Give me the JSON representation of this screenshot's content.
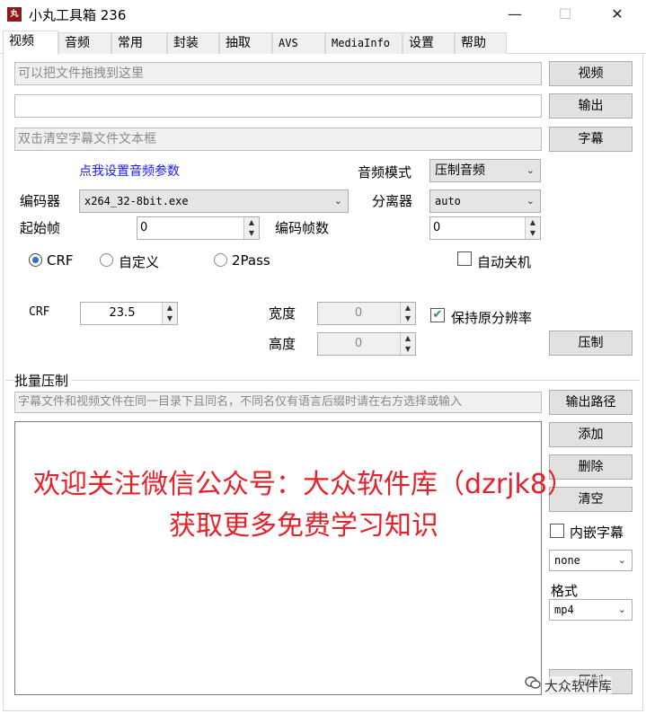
{
  "window": {
    "title": "小丸工具箱 236",
    "minimize_glyph": "—",
    "maximize_glyph": "☐",
    "close_glyph": "✕",
    "app_icon": "app-logo-icon"
  },
  "tabs": [
    {
      "label": "视频",
      "active": true
    },
    {
      "label": "音频",
      "active": false
    },
    {
      "label": "常用",
      "active": false
    },
    {
      "label": "封装",
      "active": false
    },
    {
      "label": "抽取",
      "active": false
    },
    {
      "label": "AVS",
      "active": false
    },
    {
      "label": "MediaInfo",
      "active": false
    },
    {
      "label": "设置",
      "active": false
    },
    {
      "label": "帮助",
      "active": false
    }
  ],
  "video": {
    "video_input_placeholder": "可以把文件拖拽到这里",
    "video_button": "视频",
    "output_value": "",
    "output_button": "输出",
    "subtitle_placeholder": "双击清空字幕文件文本框",
    "subtitle_button": "字幕",
    "audio_settings_link": "点我设置音频参数",
    "audio_mode_label": "音频模式",
    "audio_mode_value": "压制音频",
    "encoder_label": "编码器",
    "encoder_value": "x264_32-8bit.exe",
    "splitter_label": "分离器",
    "splitter_value": "auto",
    "start_frame_label": "起始帧",
    "start_frame_value": "0",
    "encode_frames_label": "编码帧数",
    "encode_frames_value": "0",
    "rate_modes": [
      {
        "label": "CRF",
        "selected": true
      },
      {
        "label": "自定义",
        "selected": false
      },
      {
        "label": "2Pass",
        "selected": false
      }
    ],
    "auto_shutdown_label": "自动关机",
    "auto_shutdown_checked": false,
    "crf_label": "CRF",
    "crf_value": "23.5",
    "width_label": "宽度",
    "width_value": "0",
    "height_label": "高度",
    "height_value": "0",
    "keep_resolution_label": "保持原分辨率",
    "keep_resolution_checked": true,
    "keep_resolution_glyph": "✔",
    "encode_button": "压制"
  },
  "batch": {
    "group_label": "批量压制",
    "hint_placeholder": "字幕文件和视频文件在同一目录下且同名，不同名仅有语言后缀时请在右方选择或输入",
    "output_path_button": "输出路径",
    "add_button": "添加",
    "delete_button": "删除",
    "clear_button": "清空",
    "embed_subtitle_label": "内嵌字幕",
    "embed_subtitle_checked": false,
    "subtitle_lang_value": "none",
    "format_label": "格式",
    "format_value": "mp4",
    "encode_button": "压制"
  },
  "overlay": {
    "line1": "欢迎关注微信公众号：大众软件库（dzrjk8）",
    "line2": "获取更多免费学习知识",
    "badge_text": "大众软件库",
    "badge_icon": "wechat-icon"
  },
  "colors": {
    "link": "#1a1aff",
    "watermark": "#e8202a",
    "radio_selected": "#2b73c8"
  }
}
